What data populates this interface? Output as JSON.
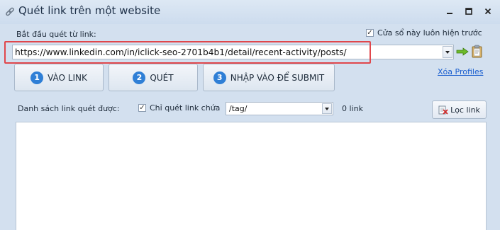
{
  "window": {
    "title": "Quét link trên một website",
    "icon": "link-icon",
    "controls": [
      "minimize-icon",
      "maximize-icon",
      "close-icon"
    ]
  },
  "start": {
    "label": "Bắt đầu quét từ link:",
    "url": "https://www.linkedin.com/in/iclick-seo-2701b4b1/detail/recent-activity/posts/",
    "always_on_top_label": "Cửa sổ này luôn hiện trước",
    "always_on_top_checked": true
  },
  "steps": [
    {
      "num": "1",
      "label": "VÀO LINK"
    },
    {
      "num": "2",
      "label": "QUÉT"
    },
    {
      "num": "3",
      "label": "NHẬP VÀO ĐỂ SUBMIT"
    }
  ],
  "xoa_profiles": "Xóa Profiles",
  "list": {
    "label": "Danh sách link quét được:",
    "filter_checkbox_label": "Chỉ quét link chứa",
    "filter_checked": true,
    "filter_value": "/tag/",
    "count": "0 link",
    "filter_button": "Lọc link",
    "items": []
  },
  "colors": {
    "background": "#d3e0ef",
    "highlight": "#e0474c",
    "step_circle": "#2f7fd6",
    "link": "#1b5fcf"
  }
}
